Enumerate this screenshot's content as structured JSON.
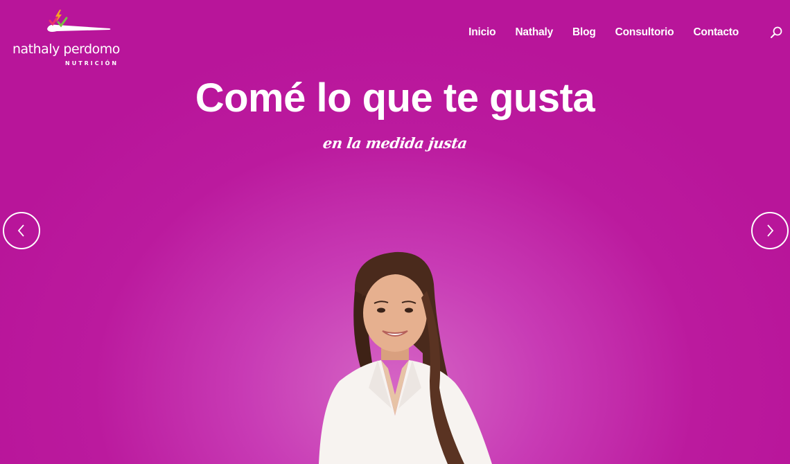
{
  "brand": {
    "name": "nathaly perdomo",
    "tagline": "NUTRICIÓN",
    "accent_colors": [
      "#f5a623",
      "#e8336d",
      "#7ac143"
    ]
  },
  "nav": {
    "items": [
      {
        "label": "Inicio"
      },
      {
        "label": "Nathaly"
      },
      {
        "label": "Blog"
      },
      {
        "label": "Consultorio"
      },
      {
        "label": "Contacto"
      }
    ],
    "search_icon": "search-icon"
  },
  "hero": {
    "title": "Comé lo que te gusta",
    "subtitle": "en la medida justa",
    "prev_icon": "chevron-left-icon",
    "next_icon": "chevron-right-icon"
  },
  "colors": {
    "background": "#b8159a",
    "text": "#ffffff"
  }
}
